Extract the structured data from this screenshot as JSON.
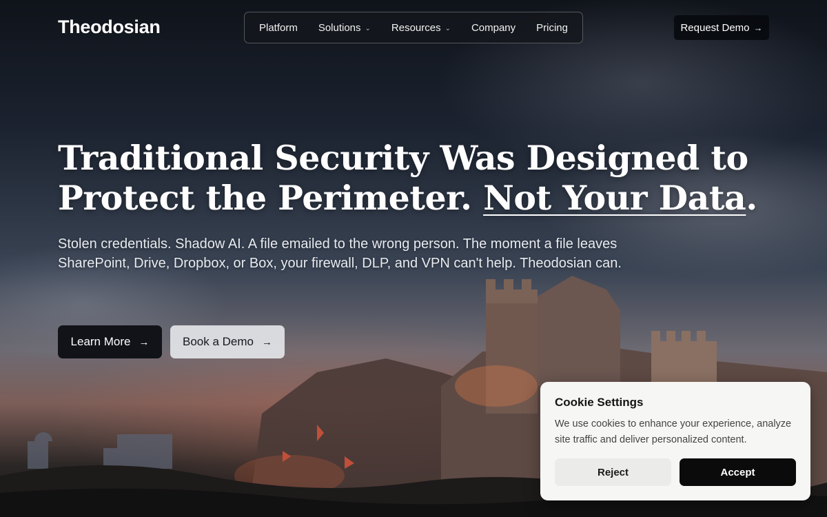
{
  "brand": {
    "name": "Theodosian"
  },
  "nav": {
    "items": [
      {
        "label": "Platform",
        "dropdown": false
      },
      {
        "label": "Solutions",
        "dropdown": true
      },
      {
        "label": "Resources",
        "dropdown": true
      },
      {
        "label": "Company",
        "dropdown": false
      },
      {
        "label": "Pricing",
        "dropdown": false
      }
    ],
    "cta_label": "Request Demo",
    "cta_icon": "arrow-right-icon"
  },
  "hero": {
    "headline_part1": "Traditional Security Was Designed to Protect the Perimeter.",
    "headline_emphasis": "Not Your Data",
    "headline_end": ".",
    "subtitle": "Stolen credentials. Shadow AI. A file emailed to the wrong person. The moment a file leaves SharePoint, Drive, Dropbox, or Box, your firewall, DLP, and VPN can't help. Theodosian can.",
    "primary_button": "Learn More",
    "secondary_button": "Book a Demo",
    "background": "siege-of-city-walls-painting"
  },
  "cookie": {
    "title": "Cookie Settings",
    "text": "We use cookies to enhance your experience, analyze site traffic and deliver personalized content.",
    "reject_label": "Reject",
    "accept_label": "Accept"
  },
  "colors": {
    "dark_button": "#111318",
    "light_button": "#e8eaee",
    "cookie_bg": "#f6f6f4",
    "accept_bg": "#0b0b0c"
  }
}
